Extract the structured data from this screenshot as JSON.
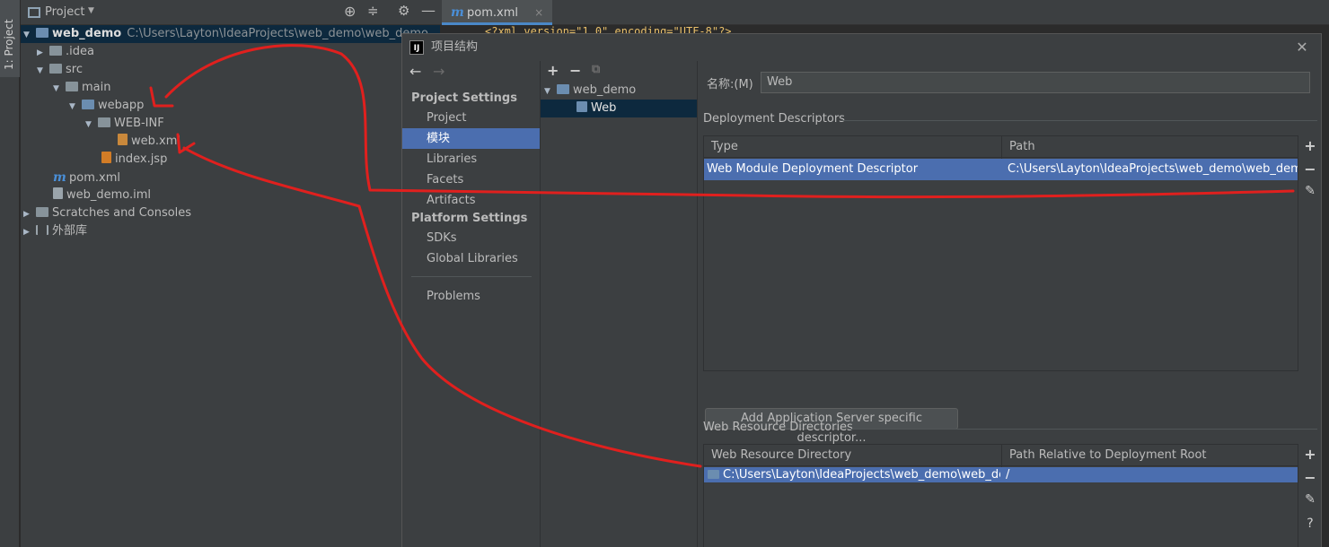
{
  "tool_strip": {
    "label": "1: Project"
  },
  "project_panel": {
    "title": "Project",
    "tree": [
      {
        "label": "web_demo",
        "path": "C:\\Users\\Layton\\IdeaProjects\\web_demo\\web_demo"
      },
      {
        "label": ".idea"
      },
      {
        "label": "src"
      },
      {
        "label": "main"
      },
      {
        "label": "webapp"
      },
      {
        "label": "WEB-INF"
      },
      {
        "label": "web.xml"
      },
      {
        "label": "index.jsp"
      },
      {
        "label": "pom.xml"
      },
      {
        "label": "web_demo.iml"
      },
      {
        "label": "Scratches and Consoles"
      },
      {
        "label": "外部库"
      }
    ]
  },
  "editor": {
    "tab_label": "pom.xml",
    "code_line": "<?xml version=\"1.0\" encoding=\"UTF-8\"?>"
  },
  "dialog": {
    "title": "项目结构",
    "logo": "IJ",
    "nav": {
      "back_icon": "arrow-left-icon",
      "forward_icon": "arrow-right-icon",
      "project_settings_header": "Project Settings",
      "project_settings": [
        "Project",
        "模块",
        "Libraries",
        "Facets",
        "Artifacts"
      ],
      "platform_settings_header": "Platform Settings",
      "platform_settings": [
        "SDKs",
        "Global Libraries"
      ],
      "problems": "Problems",
      "selected": "模块"
    },
    "modules": {
      "tree": [
        "web_demo",
        "Web"
      ],
      "selected": "Web"
    },
    "detail": {
      "name_label": "名称:(M)",
      "name_value": "Web",
      "deployment_descriptors_label": "Deployment Descriptors",
      "descriptor_columns": [
        "Type",
        "Path"
      ],
      "descriptor_rows": [
        {
          "type": "Web Module Deployment Descriptor",
          "path": "C:\\Users\\Layton\\IdeaProjects\\web_demo\\web_demo\\src"
        }
      ],
      "add_descriptor_button": "Add Application Server specific descriptor...",
      "web_resource_label": "Web Resource Directories",
      "resource_columns": [
        "Web Resource Directory",
        "Path Relative to Deployment Root"
      ],
      "resource_rows": [
        {
          "directory": "C:\\Users\\Layton\\IdeaProjects\\web_demo\\web_de...",
          "relative": "/"
        }
      ],
      "help_icon": "?"
    }
  },
  "colors": {
    "background": "#2b2b2b",
    "panel": "#3c3f41",
    "selection": "#4b6eaf",
    "tree_selection": "#0d293e",
    "annotation": "#e0201e"
  }
}
